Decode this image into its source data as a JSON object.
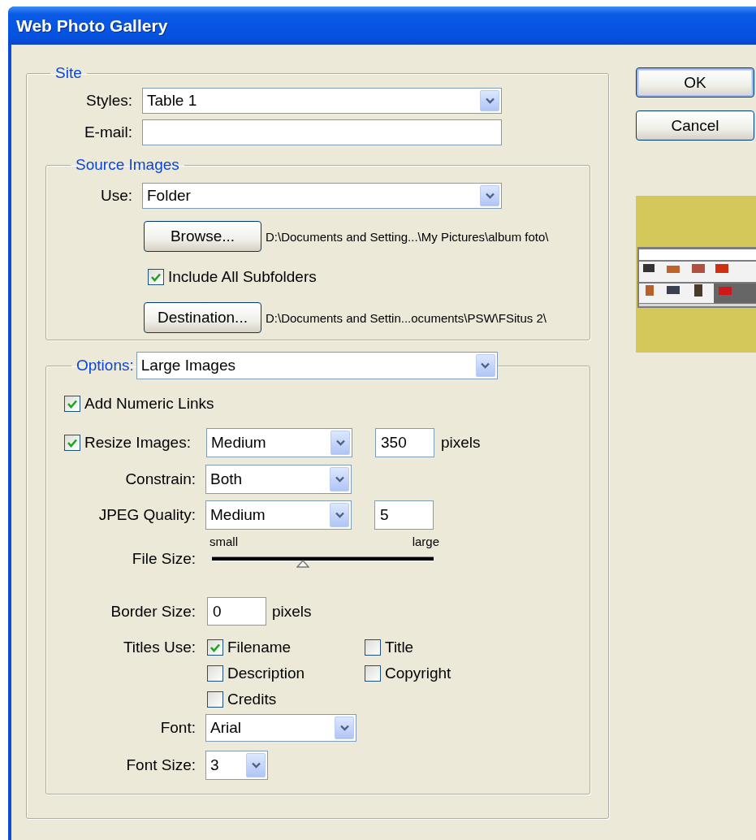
{
  "window": {
    "title": "Web Photo Gallery"
  },
  "site": {
    "legend": "Site",
    "styles": {
      "label": "Styles:",
      "value": "Table 1"
    },
    "email": {
      "label": "E-mail:"
    }
  },
  "source_images": {
    "legend": "Source Images",
    "use": {
      "label": "Use:",
      "value": "Folder"
    },
    "browse": {
      "label": "Browse...",
      "path": "D:\\Documents and Setting...\\My Pictures\\album foto\\"
    },
    "include_subfolders": {
      "label": "Include All Subfolders",
      "checked": true
    },
    "destination": {
      "label": "Destination...",
      "path": "D:\\Documents and Settin...ocuments\\PSW\\FSitus 2\\"
    }
  },
  "options": {
    "legend": "Options:",
    "value": "Large Images",
    "add_numeric_links": {
      "label": "Add Numeric Links",
      "checked": true
    },
    "resize_images": {
      "label": "Resize Images:",
      "checked": true,
      "value": "Medium",
      "size": "350",
      "unit": "pixels"
    },
    "constrain": {
      "label": "Constrain:",
      "value": "Both"
    },
    "jpeg_quality": {
      "label": "JPEG Quality:",
      "value": "Medium",
      "number": "5"
    },
    "file_size": {
      "label": "File Size:",
      "min_label": "small",
      "max_label": "large",
      "level": 0.41
    },
    "border_size": {
      "label": "Border Size:",
      "value": "0",
      "unit": "pixels"
    },
    "titles_use": {
      "label": "Titles Use:",
      "items": [
        {
          "label": "Filename",
          "checked": true
        },
        {
          "label": "Title",
          "checked": false
        },
        {
          "label": "Description",
          "checked": false
        },
        {
          "label": "Copyright",
          "checked": false
        },
        {
          "label": "Credits",
          "checked": false
        }
      ]
    },
    "font": {
      "label": "Font:",
      "value": "Arial"
    },
    "font_size": {
      "label": "Font Size:",
      "value": "3"
    }
  },
  "buttons": [
    {
      "label": "OK",
      "default": true
    },
    {
      "label": "Cancel",
      "default": false
    }
  ]
}
